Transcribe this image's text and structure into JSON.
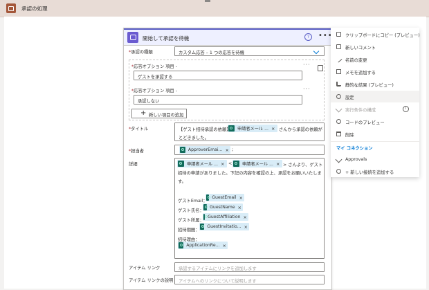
{
  "scope": {
    "title": "承認の処理"
  },
  "card": {
    "title": "開始して承認を待機",
    "help_glyph": "?",
    "more_glyph": "•••",
    "approval_type_label": "承認の種類",
    "approval_type_value": "カスタム応答 – 1 つの応答を待機",
    "option1_label": "応答オプション 項目 -",
    "option1_value": "ゲストを承認する",
    "option2_label": "応答オプション 項目 -",
    "option2_value": "承認しない",
    "add_item_label": "新しい項目の追加",
    "title_label": "タイトル",
    "title_prefix": "【ゲスト招待承認の依頼】",
    "title_token": "申請者メール ...",
    "title_suffix_1": "さんから承認の依頼が",
    "title_suffix_2": "とどきました。",
    "assigned_label": "担当者",
    "assigned_token": "ApproverEmai...",
    "assigned_suffix": ";",
    "details_label": "詳細",
    "details_token_1": "申請者メール ...",
    "details_lt": "<",
    "details_token_2": "申請者メール ...",
    "details_gt": "> さんより、ゲスト",
    "details_line2": "招待の申請がありました。下記の内容を確認の上、承認をお願いいたしま",
    "details_line3": "す。",
    "guest_email_label": "ゲストEmail：",
    "guest_email_token": "GuestEmail",
    "guest_name_label": "ゲスト氏名：",
    "guest_name_token": "GuestName",
    "guest_aff_label": "ゲスト所属：",
    "guest_aff_token": "GuestAffiliation",
    "invite_period_label": "招待期間：",
    "invite_period_token": "GuestInvitatio...",
    "reason_label": "招待理由：",
    "reason_token": "ApplicationRe...",
    "item_link_label": "アイテム リンク",
    "item_link_placeholder": "承認するアイテムにリンクを追加します",
    "item_link_desc_label": "アイテム リンクの説明",
    "item_link_desc_placeholder": "アイテムへのリンクについて説明します",
    "token_close": "×",
    "required_mark": "*"
  },
  "menu": {
    "items": [
      {
        "label": "クリップボードにコピー (プレビュー)",
        "icon": "copy-icon"
      },
      {
        "label": "新しいコメント",
        "icon": "comment-icon"
      },
      {
        "label": "名前の変更",
        "icon": "rename-icon"
      },
      {
        "label": "メモを追加する",
        "icon": "note-icon"
      },
      {
        "label": "静的な結果 (プレビュー)",
        "icon": "flask-icon"
      },
      {
        "label": "設定",
        "icon": "settings-icon"
      },
      {
        "label": "実行条件の構成",
        "icon": "run-after-icon"
      },
      {
        "label": "コードのプレビュー",
        "icon": "peek-code-icon"
      },
      {
        "label": "削除",
        "icon": "delete-icon"
      }
    ],
    "section_title": "マイ コネクション",
    "approvals_label": "Approvals",
    "add_connection_label": "+ 新しい接続を追加する",
    "info_glyph": "i"
  },
  "colors": {
    "scope_accent": "#a4573a",
    "card_accent": "#5b5fc7",
    "token_bg": "#d8ecf7",
    "token_icon": "#116b5a",
    "link_blue": "#0078d4"
  }
}
